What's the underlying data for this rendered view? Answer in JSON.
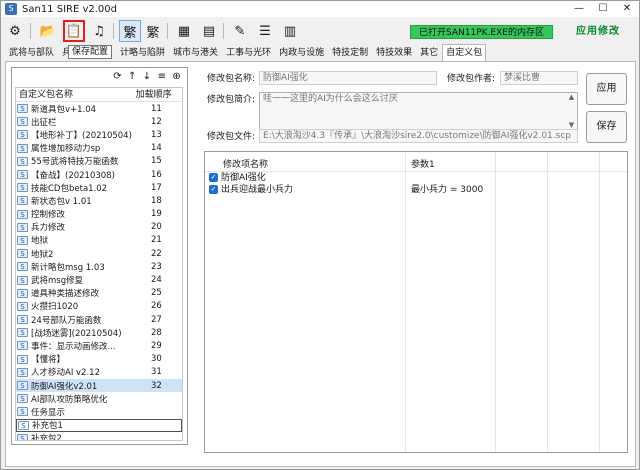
{
  "window": {
    "title": "San11 SIRE v2.00d",
    "minimize_glyph": "—",
    "maximize_glyph": "☐",
    "close_glyph": "✕"
  },
  "toolbar": {
    "status_text": "已打开SAN11PK.EXE的内存区",
    "brand_text": "应用修改",
    "tooltip": "保存配置",
    "accent_color": "#34c759",
    "highlight_color": "#e02020",
    "buttons": [
      {
        "icon": "app-icon",
        "glyph": "⚙"
      },
      {
        "icon": "folder-icon",
        "glyph": "📂"
      },
      {
        "icon": "save-config-icon",
        "glyph": "📋"
      },
      {
        "icon": "music-file-icon",
        "glyph": "♫"
      },
      {
        "icon": "traditional-chinese-icon",
        "glyph": "繁"
      },
      {
        "icon": "simplified-chinese-icon",
        "glyph": "繁"
      },
      {
        "icon": "table-icon",
        "glyph": "▦"
      },
      {
        "icon": "grid-icon",
        "glyph": "▤"
      },
      {
        "icon": "edit-pen-icon",
        "glyph": "✎"
      },
      {
        "icon": "list-icon",
        "glyph": "☰"
      },
      {
        "icon": "clipboard-icon",
        "glyph": "▥"
      }
    ]
  },
  "tabs": [
    "武将与部队",
    "兵",
    "计略与陷阱",
    "城市与港关",
    "工事与光环",
    "内政与设施",
    "特技定制",
    "特技效果",
    "其它",
    "自定义包"
  ],
  "left_panel": {
    "toolbar_glyphs": [
      "⟳",
      "↑",
      "↓",
      "≡",
      "⊕"
    ],
    "header_name": "自定义包名称",
    "header_order": "加载顺序",
    "items": [
      {
        "name": "新道具包v+1.04",
        "order": "11"
      },
      {
        "name": "出征栏",
        "order": "12"
      },
      {
        "name": "【地形补丁】(20210504)",
        "order": "13"
      },
      {
        "name": "属性增加移动力sp",
        "order": "14"
      },
      {
        "name": "55号武将特技万能函数",
        "order": "15"
      },
      {
        "name": "【奋战】(20210308)",
        "order": "16"
      },
      {
        "name": "技能CD包beta1.02",
        "order": "17"
      },
      {
        "name": "新状态包v 1.01",
        "order": "18"
      },
      {
        "name": "控制修改",
        "order": "19"
      },
      {
        "name": "兵力修改",
        "order": "20"
      },
      {
        "name": "地狱",
        "order": "21"
      },
      {
        "name": "地狱2",
        "order": "22"
      },
      {
        "name": "新计略包msg 1.03",
        "order": "23"
      },
      {
        "name": "武将msg修复",
        "order": "24"
      },
      {
        "name": "道具种类描述修改",
        "order": "25"
      },
      {
        "name": "火攒扫1020",
        "order": "26"
      },
      {
        "name": "24号部队万能函数",
        "order": "27"
      },
      {
        "name": "[战场迷雾](20210504)",
        "order": "28"
      },
      {
        "name": "事件：显示动画修改...",
        "order": "29"
      },
      {
        "name": "【懂将】",
        "order": "30"
      },
      {
        "name": "人才移动AI v2.12",
        "order": "31"
      },
      {
        "name": "防御AI强化v2.01",
        "order": "32"
      },
      {
        "name": "AI部队攻防策略优化",
        "order": ""
      },
      {
        "name": "任务显示",
        "order": ""
      },
      {
        "name": "补充包1",
        "order": ""
      },
      {
        "name": "补充包2",
        "order": ""
      }
    ]
  },
  "form": {
    "name_label": "修改包名称:",
    "name_value": "防御AI强化",
    "author_label": "修改包作者:",
    "author_value": "梦溪比曹",
    "intro_label": "修改包简介:",
    "intro_value": "哇一一这里的AI为什么会这么讨厌",
    "file_label": "修改包文件:",
    "file_value": "E:\\大浪淘沙4.3『传承』\\大浪淘沙sire2.0\\customize\\防御AI强化v2.01.scp",
    "apply_button": "应用",
    "save_button": "保存"
  },
  "grid": {
    "col_name": "修改项名称",
    "col_param": "参数1",
    "rows": [
      {
        "name": "防御AI强化",
        "param": ""
      },
      {
        "name": "出兵迎战最小兵力",
        "param": "最小兵力 = 3000"
      }
    ]
  }
}
